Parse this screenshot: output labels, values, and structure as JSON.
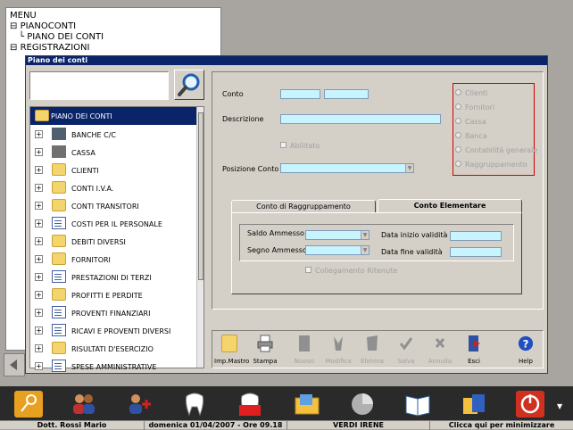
{
  "menu": {
    "items": [
      "MENU",
      "PIANOCONTI",
      "PIANO DEI CONTI",
      "REGISTRAZIONI"
    ]
  },
  "dialog": {
    "title": "Piano dei conti",
    "search": {
      "value": ""
    }
  },
  "tree": {
    "root": "PIANO DEI CONTI",
    "items": [
      {
        "label": "BANCHE C/C",
        "icon": "bank-icon"
      },
      {
        "label": "CASSA",
        "icon": "safe-icon"
      },
      {
        "label": "CLIENTI",
        "icon": "folder-icon"
      },
      {
        "label": "CONTI I.V.A.",
        "icon": "folder-icon"
      },
      {
        "label": "CONTI TRANSITORI",
        "icon": "folder-icon"
      },
      {
        "label": "COSTI PER IL PERSONALE",
        "icon": "document-icon"
      },
      {
        "label": "DEBITI DIVERSI",
        "icon": "folder-icon"
      },
      {
        "label": "FORNITORI",
        "icon": "folder-icon"
      },
      {
        "label": "PRESTAZIONI DI TERZI",
        "icon": "document-icon"
      },
      {
        "label": "PROFITTI E PERDITE",
        "icon": "folder-icon"
      },
      {
        "label": "PROVENTI FINANZIARI",
        "icon": "document-icon"
      },
      {
        "label": "RICAVI E PROVENTI DIVERSI",
        "icon": "document-icon"
      },
      {
        "label": "RISULTATI D'ESERCIZIO",
        "icon": "folder-icon"
      },
      {
        "label": "SPESE AMMINISTRATIVE",
        "icon": "document-icon"
      }
    ]
  },
  "form": {
    "conto_label": "Conto",
    "descrizione_label": "Descrizione",
    "abilitato_label": "Abilitato",
    "posizione_label": "Posizione Conto",
    "radios": [
      "Clienti",
      "Fornitori",
      "Cassa",
      "Banca",
      "Contabilità generale",
      "Raggruppamento"
    ]
  },
  "tabs": {
    "tab1": "Conto di Raggruppamento",
    "tab2": "Conto Elementare",
    "saldo_label": "Saldo Ammesso",
    "segno_label": "Segno Ammesso",
    "inizio_label": "Data inizio validità",
    "fine_label": "Data fine validità",
    "collegamento_label": "Collegamento Ritenute"
  },
  "toolbar": {
    "buttons": [
      "Imp.Mastro",
      "Stampa",
      "Nuovo",
      "Modifica",
      "Elimina",
      "Salva",
      "Annulla",
      "Esci",
      "Help"
    ]
  },
  "status": {
    "user": "Dott. Rossi Mario",
    "datetime": "domenica 01/04/2007 - Ore 09.18",
    "patient": "VERDI IRENE",
    "minimize": "Clicca qui per minimizzare"
  },
  "colors": {
    "title_bar": "#0a246a",
    "field_fill": "#c8f4ff",
    "radio_border": "#d00000"
  }
}
